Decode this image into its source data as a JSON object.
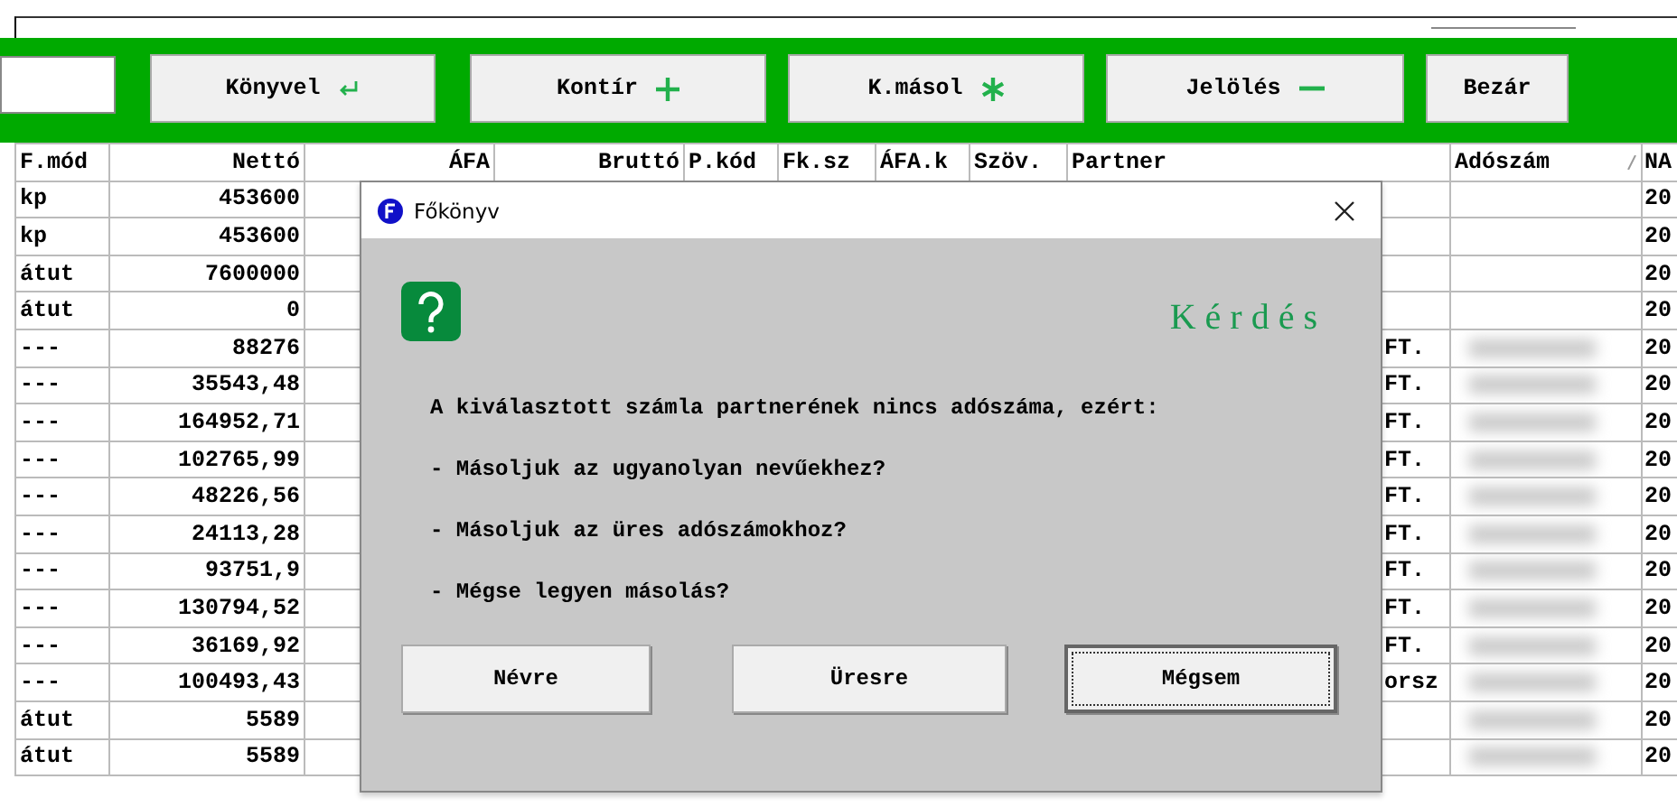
{
  "toolbar": {
    "buttons": [
      {
        "label": "Könyvel",
        "kind": "enter"
      },
      {
        "label": "Kontír",
        "kind": "plus"
      },
      {
        "label": "K.másol",
        "kind": "star"
      },
      {
        "label": "Jelölés",
        "kind": "minus"
      },
      {
        "label": "Bezár",
        "kind": "none"
      }
    ]
  },
  "table": {
    "columns": [
      {
        "label": "F.mód"
      },
      {
        "label": "Nettó"
      },
      {
        "label": "ÁFA"
      },
      {
        "label": "Bruttó"
      },
      {
        "label": "P.kód"
      },
      {
        "label": "Fk.sz"
      },
      {
        "label": "ÁFA.k"
      },
      {
        "label": "Szöv."
      },
      {
        "label": "Partner"
      },
      {
        "label": "Adószám",
        "sorted": true
      },
      {
        "label": "NA"
      }
    ],
    "rows": [
      {
        "fmod": "kp",
        "netto": "453600",
        "partner": "",
        "tax_hidden": false,
        "na": "20"
      },
      {
        "fmod": "kp",
        "netto": "453600",
        "partner": "",
        "tax_hidden": false,
        "na": "20"
      },
      {
        "fmod": "átut",
        "netto": "7600000",
        "partner": "",
        "tax_hidden": false,
        "na": "20"
      },
      {
        "fmod": "átut",
        "netto": "0",
        "partner": "",
        "tax_hidden": false,
        "na": "20"
      },
      {
        "fmod": "---",
        "netto": "88276",
        "partner": "FT.",
        "tax_hidden": true,
        "na": "20"
      },
      {
        "fmod": "---",
        "netto": "35543,48",
        "partner": "FT.",
        "tax_hidden": true,
        "na": "20"
      },
      {
        "fmod": "---",
        "netto": "164952,71",
        "partner": "FT.",
        "tax_hidden": true,
        "na": "20"
      },
      {
        "fmod": "---",
        "netto": "102765,99",
        "partner": "FT.",
        "tax_hidden": true,
        "na": "20"
      },
      {
        "fmod": "---",
        "netto": "48226,56",
        "partner": "FT.",
        "tax_hidden": true,
        "na": "20"
      },
      {
        "fmod": "---",
        "netto": "24113,28",
        "partner": "FT.",
        "tax_hidden": true,
        "na": "20"
      },
      {
        "fmod": "---",
        "netto": "93751,9",
        "partner": "FT.",
        "tax_hidden": true,
        "na": "20"
      },
      {
        "fmod": "---",
        "netto": "130794,52",
        "partner": "FT.",
        "tax_hidden": true,
        "na": "20"
      },
      {
        "fmod": "---",
        "netto": "36169,92",
        "partner": "FT.",
        "tax_hidden": true,
        "na": "20"
      },
      {
        "fmod": "---",
        "netto": "100493,43",
        "partner": "orsz",
        "tax_hidden": true,
        "na": "20"
      },
      {
        "fmod": "átut",
        "netto": "5589",
        "partner": "",
        "tax_hidden": true,
        "na": "20"
      },
      {
        "fmod": "átut",
        "netto": "5589",
        "partner": "",
        "tax_hidden": true,
        "na": "20"
      }
    ]
  },
  "dialog": {
    "title": "Főkönyv",
    "heading": "Kérdés",
    "lines": [
      "A kiválasztott számla partnerének nincs adószáma, ezért:",
      "- Másoljuk az ugyanolyan nevűekhez?",
      "- Másoljuk az üres adószámokhoz?",
      "- Mégse legyen másolás?"
    ],
    "buttons": [
      {
        "label": "Névre",
        "focused": false
      },
      {
        "label": "Üresre",
        "focused": false
      },
      {
        "label": "Mégsem",
        "focused": true
      }
    ]
  }
}
